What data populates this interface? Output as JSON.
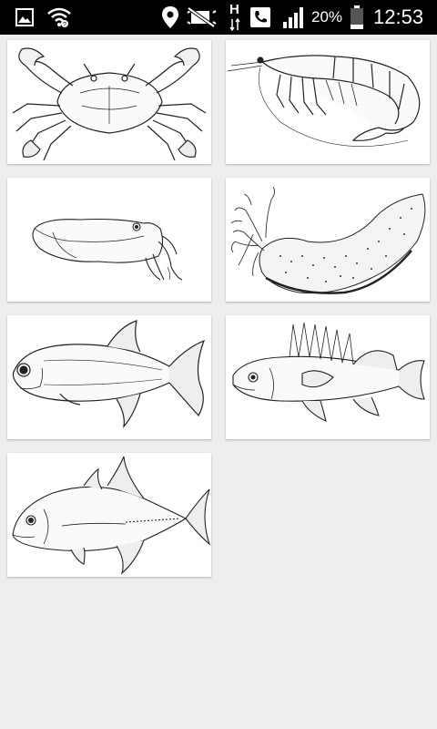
{
  "status_bar": {
    "battery_percent": "20%",
    "time": "12:53",
    "network_type": "H",
    "icons": [
      "gallery-icon",
      "wifi-icon",
      "location-icon",
      "silent-icon",
      "network-h-icon",
      "phone-icon",
      "signal-icon",
      "battery-icon"
    ]
  },
  "gallery": {
    "items": [
      {
        "subject": "crab",
        "icon": "crab-drawing"
      },
      {
        "subject": "shrimp",
        "icon": "shrimp-drawing"
      },
      {
        "subject": "cuttlefish",
        "icon": "cuttlefish-drawing"
      },
      {
        "subject": "sea-cucumber",
        "icon": "sea-cucumber-drawing"
      },
      {
        "subject": "fish",
        "icon": "fish-drawing"
      },
      {
        "subject": "perch",
        "icon": "perch-drawing"
      },
      {
        "subject": "trevally",
        "icon": "trevally-drawing"
      }
    ]
  },
  "colors": {
    "background": "#eeeeee",
    "card": "#ffffff",
    "status_bar": "#000000",
    "ink": "#222222"
  }
}
